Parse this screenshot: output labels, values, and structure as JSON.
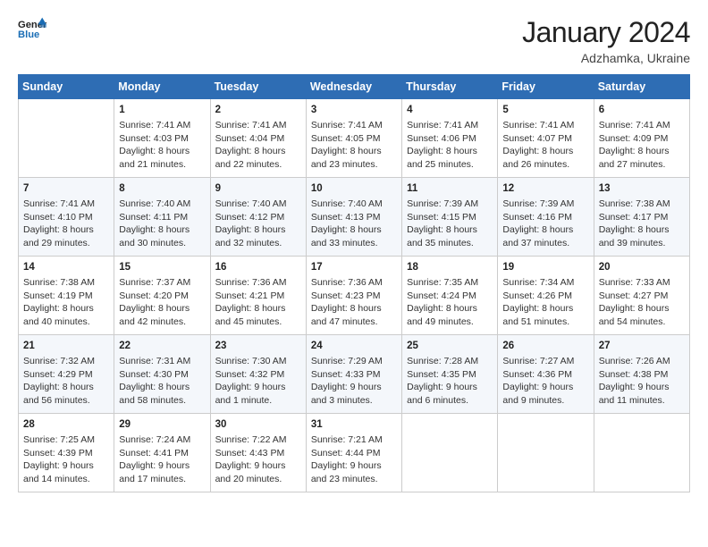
{
  "logo": {
    "line1": "General",
    "line2": "Blue"
  },
  "title": "January 2024",
  "location": "Adzhamka, Ukraine",
  "days_of_week": [
    "Sunday",
    "Monday",
    "Tuesday",
    "Wednesday",
    "Thursday",
    "Friday",
    "Saturday"
  ],
  "weeks": [
    [
      {
        "day": "",
        "sunrise": "",
        "sunset": "",
        "daylight": ""
      },
      {
        "day": "1",
        "sunrise": "Sunrise: 7:41 AM",
        "sunset": "Sunset: 4:03 PM",
        "daylight": "Daylight: 8 hours and 21 minutes."
      },
      {
        "day": "2",
        "sunrise": "Sunrise: 7:41 AM",
        "sunset": "Sunset: 4:04 PM",
        "daylight": "Daylight: 8 hours and 22 minutes."
      },
      {
        "day": "3",
        "sunrise": "Sunrise: 7:41 AM",
        "sunset": "Sunset: 4:05 PM",
        "daylight": "Daylight: 8 hours and 23 minutes."
      },
      {
        "day": "4",
        "sunrise": "Sunrise: 7:41 AM",
        "sunset": "Sunset: 4:06 PM",
        "daylight": "Daylight: 8 hours and 25 minutes."
      },
      {
        "day": "5",
        "sunrise": "Sunrise: 7:41 AM",
        "sunset": "Sunset: 4:07 PM",
        "daylight": "Daylight: 8 hours and 26 minutes."
      },
      {
        "day": "6",
        "sunrise": "Sunrise: 7:41 AM",
        "sunset": "Sunset: 4:09 PM",
        "daylight": "Daylight: 8 hours and 27 minutes."
      }
    ],
    [
      {
        "day": "7",
        "sunrise": "Sunrise: 7:41 AM",
        "sunset": "Sunset: 4:10 PM",
        "daylight": "Daylight: 8 hours and 29 minutes."
      },
      {
        "day": "8",
        "sunrise": "Sunrise: 7:40 AM",
        "sunset": "Sunset: 4:11 PM",
        "daylight": "Daylight: 8 hours and 30 minutes."
      },
      {
        "day": "9",
        "sunrise": "Sunrise: 7:40 AM",
        "sunset": "Sunset: 4:12 PM",
        "daylight": "Daylight: 8 hours and 32 minutes."
      },
      {
        "day": "10",
        "sunrise": "Sunrise: 7:40 AM",
        "sunset": "Sunset: 4:13 PM",
        "daylight": "Daylight: 8 hours and 33 minutes."
      },
      {
        "day": "11",
        "sunrise": "Sunrise: 7:39 AM",
        "sunset": "Sunset: 4:15 PM",
        "daylight": "Daylight: 8 hours and 35 minutes."
      },
      {
        "day": "12",
        "sunrise": "Sunrise: 7:39 AM",
        "sunset": "Sunset: 4:16 PM",
        "daylight": "Daylight: 8 hours and 37 minutes."
      },
      {
        "day": "13",
        "sunrise": "Sunrise: 7:38 AM",
        "sunset": "Sunset: 4:17 PM",
        "daylight": "Daylight: 8 hours and 39 minutes."
      }
    ],
    [
      {
        "day": "14",
        "sunrise": "Sunrise: 7:38 AM",
        "sunset": "Sunset: 4:19 PM",
        "daylight": "Daylight: 8 hours and 40 minutes."
      },
      {
        "day": "15",
        "sunrise": "Sunrise: 7:37 AM",
        "sunset": "Sunset: 4:20 PM",
        "daylight": "Daylight: 8 hours and 42 minutes."
      },
      {
        "day": "16",
        "sunrise": "Sunrise: 7:36 AM",
        "sunset": "Sunset: 4:21 PM",
        "daylight": "Daylight: 8 hours and 45 minutes."
      },
      {
        "day": "17",
        "sunrise": "Sunrise: 7:36 AM",
        "sunset": "Sunset: 4:23 PM",
        "daylight": "Daylight: 8 hours and 47 minutes."
      },
      {
        "day": "18",
        "sunrise": "Sunrise: 7:35 AM",
        "sunset": "Sunset: 4:24 PM",
        "daylight": "Daylight: 8 hours and 49 minutes."
      },
      {
        "day": "19",
        "sunrise": "Sunrise: 7:34 AM",
        "sunset": "Sunset: 4:26 PM",
        "daylight": "Daylight: 8 hours and 51 minutes."
      },
      {
        "day": "20",
        "sunrise": "Sunrise: 7:33 AM",
        "sunset": "Sunset: 4:27 PM",
        "daylight": "Daylight: 8 hours and 54 minutes."
      }
    ],
    [
      {
        "day": "21",
        "sunrise": "Sunrise: 7:32 AM",
        "sunset": "Sunset: 4:29 PM",
        "daylight": "Daylight: 8 hours and 56 minutes."
      },
      {
        "day": "22",
        "sunrise": "Sunrise: 7:31 AM",
        "sunset": "Sunset: 4:30 PM",
        "daylight": "Daylight: 8 hours and 58 minutes."
      },
      {
        "day": "23",
        "sunrise": "Sunrise: 7:30 AM",
        "sunset": "Sunset: 4:32 PM",
        "daylight": "Daylight: 9 hours and 1 minute."
      },
      {
        "day": "24",
        "sunrise": "Sunrise: 7:29 AM",
        "sunset": "Sunset: 4:33 PM",
        "daylight": "Daylight: 9 hours and 3 minutes."
      },
      {
        "day": "25",
        "sunrise": "Sunrise: 7:28 AM",
        "sunset": "Sunset: 4:35 PM",
        "daylight": "Daylight: 9 hours and 6 minutes."
      },
      {
        "day": "26",
        "sunrise": "Sunrise: 7:27 AM",
        "sunset": "Sunset: 4:36 PM",
        "daylight": "Daylight: 9 hours and 9 minutes."
      },
      {
        "day": "27",
        "sunrise": "Sunrise: 7:26 AM",
        "sunset": "Sunset: 4:38 PM",
        "daylight": "Daylight: 9 hours and 11 minutes."
      }
    ],
    [
      {
        "day": "28",
        "sunrise": "Sunrise: 7:25 AM",
        "sunset": "Sunset: 4:39 PM",
        "daylight": "Daylight: 9 hours and 14 minutes."
      },
      {
        "day": "29",
        "sunrise": "Sunrise: 7:24 AM",
        "sunset": "Sunset: 4:41 PM",
        "daylight": "Daylight: 9 hours and 17 minutes."
      },
      {
        "day": "30",
        "sunrise": "Sunrise: 7:22 AM",
        "sunset": "Sunset: 4:43 PM",
        "daylight": "Daylight: 9 hours and 20 minutes."
      },
      {
        "day": "31",
        "sunrise": "Sunrise: 7:21 AM",
        "sunset": "Sunset: 4:44 PM",
        "daylight": "Daylight: 9 hours and 23 minutes."
      },
      {
        "day": "",
        "sunrise": "",
        "sunset": "",
        "daylight": ""
      },
      {
        "day": "",
        "sunrise": "",
        "sunset": "",
        "daylight": ""
      },
      {
        "day": "",
        "sunrise": "",
        "sunset": "",
        "daylight": ""
      }
    ]
  ]
}
